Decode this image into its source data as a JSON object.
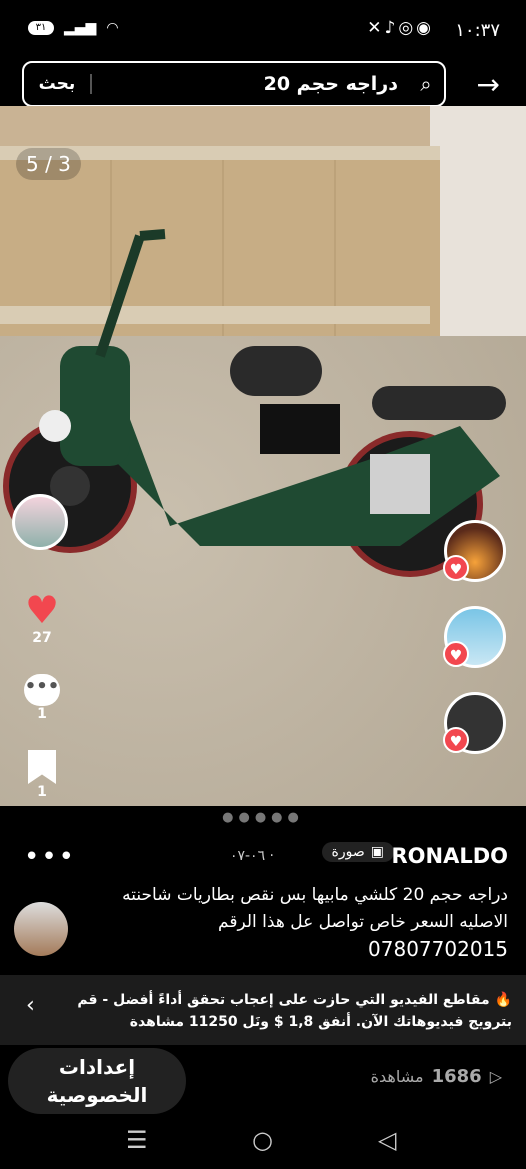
{
  "status": {
    "time": "١٠:٣٧",
    "battery": "٣١",
    "notification_icons": "✕♪◎◉"
  },
  "search": {
    "query": "دراجه حجم 20",
    "button_label": "بحث"
  },
  "media": {
    "counter": "5 / 3",
    "pager_dots": "●●●●●"
  },
  "actions": {
    "likes": "27",
    "comments": "1",
    "saves": "1"
  },
  "post": {
    "author": "RONALDO",
    "type_label": "صورة",
    "date": "٠٦-٠٧ ·",
    "description": "دراجه حجم 20 كلشي مابيها بس نقص بطاريات شاحنته الاصليه السعر خاص تواصل عل هذا الرقم",
    "phone": "07807702015"
  },
  "promo": {
    "text": "مقاطع الفيديو التي حازت على إعجاب تحقق أداءً أفضل - قم بترويج فيديوهاتك الآن. أنفق 1,8 $ ونَل 11250 مشاهدة"
  },
  "bottom": {
    "privacy_line1": "إعدادات",
    "privacy_line2": "الخصوصية",
    "views_count": "1686",
    "views_label": "مشاهدة"
  },
  "colors": {
    "accent": "#f2474f",
    "background": "#000000"
  }
}
